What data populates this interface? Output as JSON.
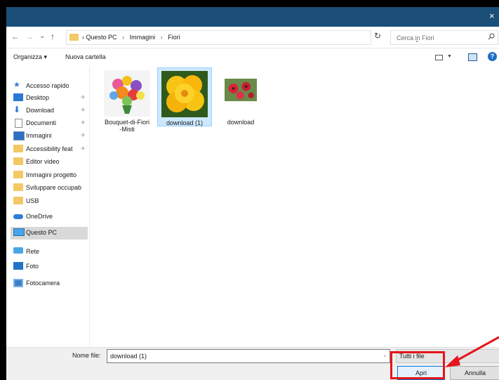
{
  "window": {
    "close_glyph": "×"
  },
  "nav": {
    "back": "←",
    "forward": "→",
    "history": "⌄",
    "up": "↑"
  },
  "address": {
    "crumbs": [
      "Questo PC",
      "Immagini",
      "Fiori"
    ],
    "sep": "›",
    "dropdown": "⌄",
    "refresh": "↻"
  },
  "search": {
    "placeholder": "Cerca in Fiori",
    "icon": "search-icon"
  },
  "toolbar": {
    "organize": "Organizza ▾",
    "new_folder": "Nuova cartella",
    "help": "?"
  },
  "sidebar": {
    "items": [
      {
        "label": "Accesso rapido",
        "icon": "star-icon"
      },
      {
        "label": "Desktop",
        "icon": "desktop-icon",
        "pinned": true
      },
      {
        "label": "Download",
        "icon": "download-icon",
        "pinned": true
      },
      {
        "label": "Documenti",
        "icon": "document-icon",
        "pinned": true
      },
      {
        "label": "Immagini",
        "icon": "pictures-icon",
        "pinned": true
      },
      {
        "label": "Accessibility feat",
        "icon": "folder-icon",
        "pinned": true
      },
      {
        "label": "Editor video",
        "icon": "folder-icon"
      },
      {
        "label": "Immagini progetto",
        "icon": "folder-icon"
      },
      {
        "label": "Sviluppare occupab",
        "icon": "folder-icon"
      },
      {
        "label": "USB",
        "icon": "folder-icon"
      },
      {
        "label": "OneDrive",
        "icon": "cloud-icon"
      },
      {
        "label": "Questo PC",
        "icon": "computer-icon",
        "selected": true
      },
      {
        "label": "Rete",
        "icon": "network-icon"
      },
      {
        "label": "Foto",
        "icon": "photos-icon"
      },
      {
        "label": "Fotocamera",
        "icon": "camera-icon"
      }
    ],
    "pin_glyph": "✈"
  },
  "files": [
    {
      "name": "Bouquet-di-Fiori\n-Misti",
      "thumb": "bouquet-thumbnail"
    },
    {
      "name": "download (1)",
      "thumb": "yellow-flower-thumbnail",
      "selected": true
    },
    {
      "name": "download",
      "thumb": "red-flowers-thumbnail"
    }
  ],
  "bottom": {
    "filename_label": "Nome file:",
    "filename_value": "download (1)",
    "filter_value": "Tutti i file",
    "open_label": "Apri",
    "cancel_label": "Annulla"
  },
  "colors": {
    "titlebar": "#1b4e79",
    "highlight": "#e6141b",
    "selection": "#cce8ff"
  }
}
